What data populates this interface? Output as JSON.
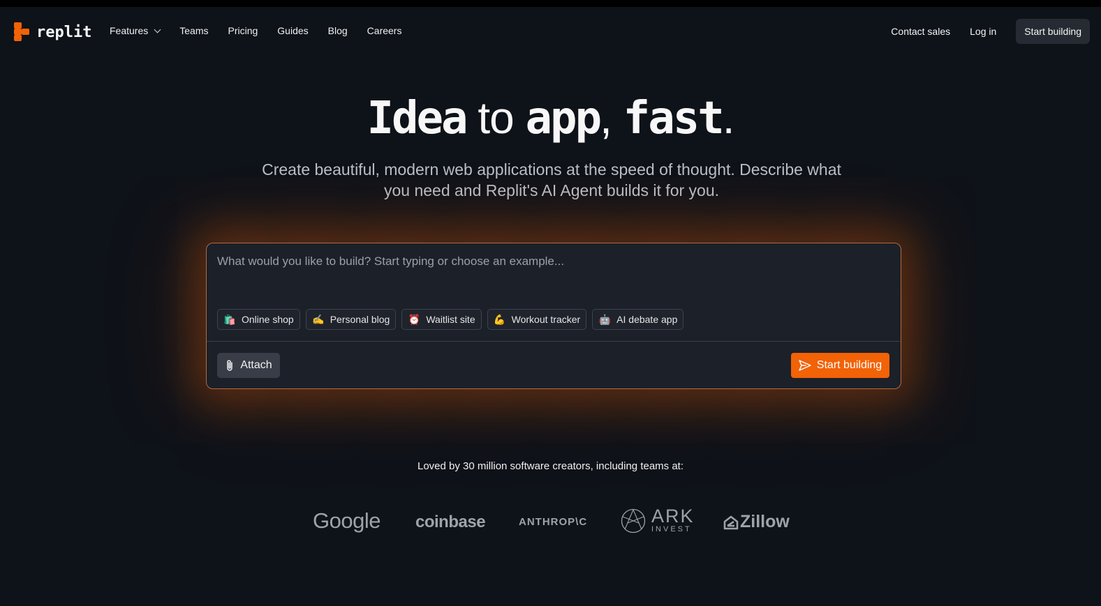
{
  "brand": {
    "name": "replit",
    "accent": "#f26207"
  },
  "nav": {
    "links": [
      {
        "label": "Features",
        "has_dropdown": true
      },
      {
        "label": "Teams"
      },
      {
        "label": "Pricing"
      },
      {
        "label": "Guides"
      },
      {
        "label": "Blog"
      },
      {
        "label": "Careers"
      }
    ],
    "contact_sales": "Contact sales",
    "log_in": "Log in",
    "start_building": "Start building"
  },
  "hero": {
    "title_parts": [
      "Idea",
      " to ",
      "app",
      ", ",
      "fast",
      "."
    ],
    "subtitle": "Create beautiful, modern web applications at the speed of thought. Describe what you need and Replit's AI Agent builds it for you."
  },
  "prompt": {
    "placeholder": "What would you like to build? Start typing or choose an example...",
    "examples": [
      {
        "icon": "shopping-bags-icon",
        "glyph": "🛍️",
        "label": "Online shop"
      },
      {
        "icon": "writing-hand-icon",
        "glyph": "✍️",
        "label": "Personal blog"
      },
      {
        "icon": "alarm-clock-icon",
        "glyph": "⏰",
        "label": "Waitlist site"
      },
      {
        "icon": "flexed-biceps-icon",
        "glyph": "💪",
        "label": "Workout tracker"
      },
      {
        "icon": "robot-icon",
        "glyph": "🤖",
        "label": "AI debate app"
      }
    ],
    "attach_label": "Attach",
    "submit_label": "Start building"
  },
  "social_proof": {
    "text": "Loved by 30 million software creators, including teams at:",
    "logos": {
      "google": "Google",
      "coinbase": "coinbase",
      "anthropic": "ANTHROP\\C",
      "ark_main": "ARK",
      "ark_sub": "INVEST",
      "zillow": "Zillow"
    }
  }
}
